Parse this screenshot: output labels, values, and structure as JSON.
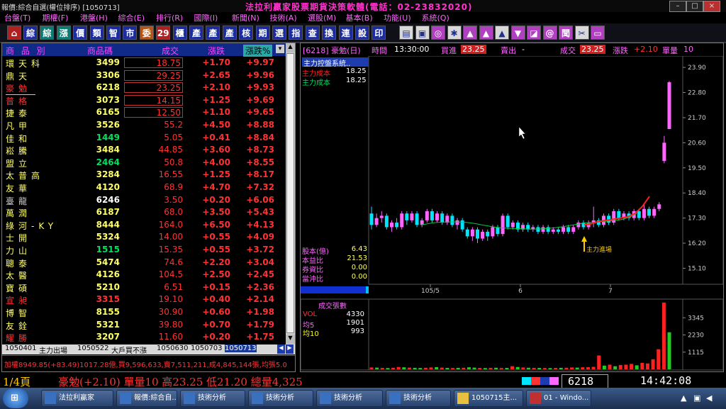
{
  "window": {
    "title": "報價:綜合自選(權位排序) [1050713]",
    "app_banner": "法拉利贏家股票期貨決策軟體(電話：02-23832020)"
  },
  "menu": [
    "台盤(T)",
    "期權(F)",
    "港盤(H)",
    "綜合(E)",
    "排行(R)",
    "國際(I)",
    "新聞(N)",
    "技術(A)",
    "選股(M)",
    "基本(B)",
    "功能(U)",
    "系統(Q)"
  ],
  "toolbar": {
    "text_buttons": [
      "綜",
      "綜",
      "漲",
      "價",
      "類",
      "智",
      "市",
      "委",
      "29",
      "櫃",
      "產",
      "產",
      "產",
      "核",
      "期",
      "選",
      "指",
      "查",
      "換",
      "連",
      "設",
      "印"
    ]
  },
  "quote_table": {
    "headers": {
      "name": "商 品 別",
      "code": "商品碼",
      "price": "成交",
      "change": "漲跌",
      "pct": "漲跌%"
    },
    "rows": [
      {
        "name": "環天科",
        "code": "3499",
        "price": "18.75",
        "change": "+1.70",
        "pct": "+9.97"
      },
      {
        "name": "鼎天",
        "code": "3306",
        "price": "29.25",
        "change": "+2.65",
        "pct": "+9.96"
      },
      {
        "name": "豪勉",
        "code": "6218",
        "price": "23.25",
        "change": "+2.10",
        "pct": "+9.93"
      },
      {
        "name": "普格",
        "code": "3073",
        "price": "14.15",
        "change": "+1.25",
        "pct": "+9.69"
      },
      {
        "name": "捷泰",
        "code": "6165",
        "price": "12.50",
        "change": "+1.10",
        "pct": "+9.65"
      },
      {
        "name": "凡甲",
        "code": "3526",
        "price": "55.2",
        "change": "+4.50",
        "pct": "+8.88"
      },
      {
        "name": "佳和",
        "code": "1449",
        "price": "5.05",
        "change": "+0.41",
        "pct": "+8.84"
      },
      {
        "name": "崧騰",
        "code": "3484",
        "price": "44.85",
        "change": "+3.60",
        "pct": "+8.73"
      },
      {
        "name": "盟立",
        "code": "2464",
        "price": "50.8",
        "change": "+4.00",
        "pct": "+8.55"
      },
      {
        "name": "太普高",
        "code": "3284",
        "price": "16.55",
        "change": "+1.25",
        "pct": "+8.17"
      },
      {
        "name": "友華",
        "code": "4120",
        "price": "68.9",
        "change": "+4.70",
        "pct": "+7.32"
      },
      {
        "name": "臺龍",
        "code": "6246",
        "price": "3.50",
        "change": "+0.20",
        "pct": "+6.06"
      },
      {
        "name": "萬潤",
        "code": "6187",
        "price": "68.0",
        "change": "+3.50",
        "pct": "+5.43"
      },
      {
        "name": "綠河-KY",
        "code": "8444",
        "price": "164.0",
        "change": "+6.50",
        "pct": "+4.13"
      },
      {
        "name": "士開",
        "code": "5324",
        "price": "14.00",
        "change": "+0.55",
        "pct": "+4.09"
      },
      {
        "name": "力山",
        "code": "1515",
        "price": "15.35",
        "change": "+0.55",
        "pct": "+3.72"
      },
      {
        "name": "聰泰",
        "code": "5474",
        "price": "74.6",
        "change": "+2.20",
        "pct": "+3.04"
      },
      {
        "name": "太醫",
        "code": "4126",
        "price": "104.5",
        "change": "+2.50",
        "pct": "+2.45"
      },
      {
        "name": "寶碩",
        "code": "5210",
        "price": "6.51",
        "change": "+0.15",
        "pct": "+2.36"
      },
      {
        "name": "宣昶",
        "code": "3315",
        "price": "19.10",
        "change": "+0.40",
        "pct": "+2.14"
      },
      {
        "name": "博智",
        "code": "8155",
        "price": "30.90",
        "change": "+0.60",
        "pct": "+1.98"
      },
      {
        "name": "友銓",
        "code": "5321",
        "price": "39.80",
        "change": "+0.70",
        "pct": "+1.79"
      },
      {
        "name": "耀勝",
        "code": "3207",
        "price": "11.60",
        "change": "+0.20",
        "pct": "+1.75"
      }
    ]
  },
  "tabs": [
    "1050401",
    "主力出場",
    "1050522",
    "大戶買不漲",
    "1050630",
    "1050703",
    "1050713"
  ],
  "ticker": "加權8949.85(+83.49)1017.28億,買9,596,633,賣7,511,211,成4,845,144張,均張5.0",
  "chart_header": {
    "code": "[6218] 豪勉(日)",
    "time_label": "時間",
    "time": "13:30:00",
    "buy_label": "買進",
    "buy": "23.25",
    "sell_label": "賣出",
    "sell": "-",
    "deal_label": "成交",
    "deal": "23.25",
    "chg_label": "漲跌",
    "chg": "+2.10",
    "vol_label": "單量",
    "vol": "10"
  },
  "chart_overlay": {
    "system_label": "主力控盤系統..",
    "cost1_label": "主力成本",
    "cost1": "18.25",
    "cost2_label": "主力成本",
    "cost2": "18.25",
    "stats": [
      {
        "label": "股本(億)",
        "value": "6.43"
      },
      {
        "label": "本益比",
        "value": "21.53"
      },
      {
        "label": "券資比",
        "value": "0.00"
      },
      {
        "label": "當沖比",
        "value": "0.00"
      }
    ],
    "entry_label": "主力進場"
  },
  "volume_overlay": {
    "title": "成交張數",
    "vol_label": "VOL",
    "vol": "4330",
    "ma5_label": "均5",
    "ma5": "1901",
    "ma10_label": "均10",
    "ma10": "993"
  },
  "chart_data": {
    "type": "candlestick",
    "price_ticks": [
      "23.90",
      "22.80",
      "21.70",
      "20.60",
      "19.50",
      "18.40",
      "17.30",
      "16.20",
      "15.10"
    ],
    "price_range": [
      14.4,
      24.4
    ],
    "x_ticks": [
      "105/5",
      "6",
      "7"
    ],
    "volume_ticks": [
      "3345",
      "2230",
      "1115"
    ],
    "volume_range": [
      0,
      4460
    ],
    "colors": {
      "up": "#ff66ff",
      "down": "#00e5ff",
      "ma": "#00cc44",
      "cost": "#ff2020",
      "vol_up": "#ff2020",
      "vol_down": "#22cc22"
    },
    "candles": [
      {
        "o": 17.5,
        "c": 17.0,
        "h": 17.8,
        "l": 16.8
      },
      {
        "o": 17.0,
        "c": 17.3,
        "h": 17.5,
        "l": 16.9
      },
      {
        "o": 17.3,
        "c": 17.4,
        "h": 17.6,
        "l": 17.1
      },
      {
        "o": 17.4,
        "c": 16.9,
        "h": 17.5,
        "l": 16.8
      },
      {
        "o": 16.9,
        "c": 17.1,
        "h": 17.2,
        "l": 16.7
      },
      {
        "o": 17.1,
        "c": 16.9,
        "h": 17.3,
        "l": 16.8
      },
      {
        "o": 16.9,
        "c": 17.5,
        "h": 17.6,
        "l": 16.8
      },
      {
        "o": 17.5,
        "c": 17.2,
        "h": 17.6,
        "l": 17.0
      },
      {
        "o": 17.2,
        "c": 17.5,
        "h": 17.6,
        "l": 17.1
      },
      {
        "o": 17.5,
        "c": 17.0,
        "h": 17.6,
        "l": 16.9
      },
      {
        "o": 17.0,
        "c": 17.2,
        "h": 17.3,
        "l": 16.9
      },
      {
        "o": 17.2,
        "c": 17.6,
        "h": 17.7,
        "l": 17.1
      },
      {
        "o": 17.6,
        "c": 17.2,
        "h": 17.7,
        "l": 17.1
      },
      {
        "o": 17.2,
        "c": 17.5,
        "h": 17.6,
        "l": 17.1
      },
      {
        "o": 17.5,
        "c": 17.1,
        "h": 17.6,
        "l": 17.0
      },
      {
        "o": 17.1,
        "c": 17.4,
        "h": 17.5,
        "l": 17.0
      },
      {
        "o": 17.4,
        "c": 17.0,
        "h": 17.5,
        "l": 16.9
      },
      {
        "o": 17.0,
        "c": 17.2,
        "h": 17.3,
        "l": 16.8
      },
      {
        "o": 17.2,
        "c": 16.8,
        "h": 17.3,
        "l": 16.7
      },
      {
        "o": 16.8,
        "c": 16.5,
        "h": 16.9,
        "l": 16.4
      },
      {
        "o": 16.5,
        "c": 16.8,
        "h": 16.9,
        "l": 16.3
      },
      {
        "o": 16.8,
        "c": 16.4,
        "h": 16.9,
        "l": 16.2
      },
      {
        "o": 16.4,
        "c": 16.7,
        "h": 16.8,
        "l": 16.3
      },
      {
        "o": 16.7,
        "c": 16.5,
        "h": 16.8,
        "l": 16.3
      },
      {
        "o": 16.5,
        "c": 16.9,
        "h": 17.0,
        "l": 16.4
      },
      {
        "o": 16.9,
        "c": 16.6,
        "h": 17.0,
        "l": 16.5
      },
      {
        "o": 16.6,
        "c": 17.4,
        "h": 17.5,
        "l": 16.5
      },
      {
        "o": 17.4,
        "c": 16.9,
        "h": 17.5,
        "l": 16.8
      },
      {
        "o": 16.9,
        "c": 17.1,
        "h": 17.2,
        "l": 16.8
      },
      {
        "o": 17.1,
        "c": 16.8,
        "h": 17.2,
        "l": 16.7
      },
      {
        "o": 16.8,
        "c": 17.0,
        "h": 17.1,
        "l": 16.7
      },
      {
        "o": 17.0,
        "c": 16.8,
        "h": 17.1,
        "l": 16.7
      },
      {
        "o": 16.8,
        "c": 16.9,
        "h": 17.0,
        "l": 16.7
      },
      {
        "o": 16.9,
        "c": 16.7,
        "h": 17.0,
        "l": 16.6
      },
      {
        "o": 16.7,
        "c": 16.9,
        "h": 17.0,
        "l": 16.6
      },
      {
        "o": 16.9,
        "c": 16.7,
        "h": 17.0,
        "l": 16.6
      },
      {
        "o": 16.7,
        "c": 16.8,
        "h": 16.9,
        "l": 16.6
      },
      {
        "o": 16.8,
        "c": 16.7,
        "h": 16.9,
        "l": 16.6
      },
      {
        "o": 16.7,
        "c": 16.9,
        "h": 17.0,
        "l": 16.6
      },
      {
        "o": 16.9,
        "c": 16.7,
        "h": 17.0,
        "l": 16.6
      },
      {
        "o": 16.7,
        "c": 16.9,
        "h": 17.0,
        "l": 16.6
      },
      {
        "o": 16.9,
        "c": 17.1,
        "h": 17.2,
        "l": 16.8
      },
      {
        "o": 17.1,
        "c": 16.9,
        "h": 17.2,
        "l": 16.8
      },
      {
        "o": 16.9,
        "c": 17.1,
        "h": 17.2,
        "l": 16.8
      },
      {
        "o": 17.1,
        "c": 17.2,
        "h": 17.8,
        "l": 16.9
      },
      {
        "o": 17.2,
        "c": 17.0,
        "h": 17.3,
        "l": 16.9
      },
      {
        "o": 17.0,
        "c": 17.4,
        "h": 17.5,
        "l": 16.9
      },
      {
        "o": 17.4,
        "c": 17.1,
        "h": 17.5,
        "l": 17.0
      },
      {
        "o": 17.1,
        "c": 17.6,
        "h": 17.7,
        "l": 17.0
      },
      {
        "o": 17.6,
        "c": 17.3,
        "h": 17.7,
        "l": 17.2
      },
      {
        "o": 17.3,
        "c": 17.5,
        "h": 17.6,
        "l": 17.2
      },
      {
        "o": 17.5,
        "c": 17.3,
        "h": 17.6,
        "l": 17.2
      },
      {
        "o": 17.3,
        "c": 17.6,
        "h": 17.7,
        "l": 17.2
      },
      {
        "o": 17.6,
        "c": 17.3,
        "h": 17.7,
        "l": 17.2
      },
      {
        "o": 17.3,
        "c": 17.7,
        "h": 17.9,
        "l": 17.2
      },
      {
        "o": 17.7,
        "c": 17.4,
        "h": 17.8,
        "l": 17.3
      },
      {
        "o": 17.4,
        "c": 17.7,
        "h": 17.8,
        "l": 17.3
      },
      {
        "o": 17.7,
        "c": 17.9,
        "h": 18.0,
        "l": 17.6
      },
      {
        "o": 19.8,
        "c": 20.6,
        "h": 20.9,
        "l": 19.7
      },
      {
        "o": 21.2,
        "c": 23.25,
        "h": 23.3,
        "l": 21.2
      }
    ],
    "ma_line": [
      17.0,
      17.05,
      17.1,
      17.12,
      17.13,
      17.13,
      17.12,
      17.1,
      17.06,
      17.0,
      16.95,
      16.9,
      16.87,
      16.85,
      16.84,
      16.83,
      16.82,
      16.82,
      16.83,
      16.85,
      16.88,
      16.92,
      16.97,
      17.02,
      17.07,
      17.1,
      17.13,
      17.15,
      17.17,
      17.2,
      17.25,
      17.35,
      17.5
    ],
    "cost_line": [
      17.0,
      17.05,
      17.15,
      17.2,
      17.25,
      17.3,
      17.35,
      17.5,
      17.8,
      18.25
    ],
    "volumes": [
      120,
      110,
      90,
      80,
      100,
      150,
      130,
      110,
      95,
      85,
      100,
      120,
      140,
      110,
      90,
      85,
      95,
      100,
      130,
      110,
      90,
      80,
      95,
      100,
      85,
      90,
      200,
      150,
      120,
      100,
      95,
      90,
      85,
      80,
      90,
      95,
      100,
      120,
      110,
      130,
      140,
      160,
      900,
      240,
      300,
      200,
      280,
      300,
      350,
      260,
      420,
      380,
      650,
      1300,
      4330,
      2400
    ],
    "volume_dir": [
      1,
      0,
      1,
      0,
      1,
      1,
      0,
      1,
      0,
      0,
      1,
      1,
      0,
      1,
      0,
      1,
      0,
      1,
      0,
      0,
      1,
      0,
      1,
      0,
      1,
      0,
      1,
      0,
      1,
      0,
      1,
      0,
      1,
      0,
      1,
      0,
      1,
      1,
      0,
      1,
      1,
      1,
      1,
      0,
      1,
      0,
      1,
      1,
      1,
      0,
      1,
      1,
      1,
      1,
      1,
      0
    ]
  },
  "status_bar": {
    "page": "1/4頁",
    "summary": "豪勉(+2.10) 單量10 高23.25 低21.20 總量4,325",
    "code": "6218",
    "time": "14:42:08"
  },
  "taskbar": [
    "法拉利贏家",
    "報價:綜合自...",
    "技術分析",
    "技術分析",
    "技術分析",
    "技術分析",
    "1050715主...",
    "01 - Windo..."
  ]
}
